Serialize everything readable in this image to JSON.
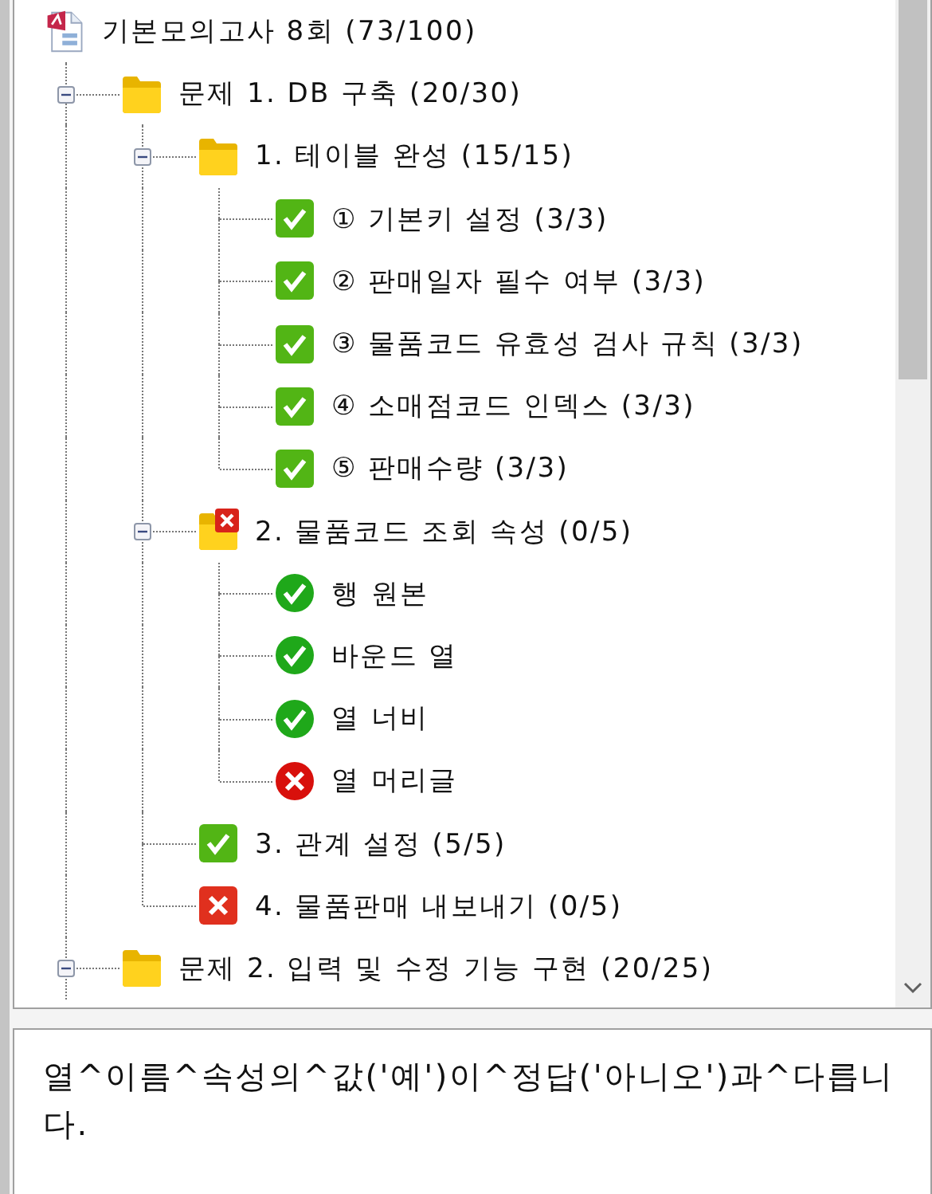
{
  "tree": [
    {
      "label": "기본모의고사 8회 (73/100)",
      "kind": "document",
      "children": [
        {
          "label": "문제 1. DB 구축 (20/30)",
          "kind": "folder",
          "passed": true,
          "expanded": true,
          "children": [
            {
              "label": "1. 테이블 완성 (15/15)",
              "kind": "folder",
              "passed": true,
              "expanded": true,
              "children": [
                {
                  "label": "① 기본키 설정 (3/3)",
                  "kind": "task",
                  "passed": true
                },
                {
                  "label": "② 판매일자 필수 여부 (3/3)",
                  "kind": "task",
                  "passed": true
                },
                {
                  "label": "③ 물품코드 유효성 검사 규칙 (3/3)",
                  "kind": "task",
                  "passed": true
                },
                {
                  "label": "④ 소매점코드 인덱스 (3/3)",
                  "kind": "task",
                  "passed": true
                },
                {
                  "label": "⑤ 판매수량 (3/3)",
                  "kind": "task",
                  "passed": true
                }
              ]
            },
            {
              "label": "2. 물품코드 조회 속성 (0/5)",
              "kind": "folder",
              "passed": false,
              "expanded": true,
              "children": [
                {
                  "label": "행 원본",
                  "kind": "check",
                  "passed": true
                },
                {
                  "label": "바운드 열",
                  "kind": "check",
                  "passed": true
                },
                {
                  "label": "열 너비",
                  "kind": "check",
                  "passed": true
                },
                {
                  "label": "열 머리글",
                  "kind": "check",
                  "passed": false
                }
              ]
            },
            {
              "label": "3. 관계 설정 (5/5)",
              "kind": "task",
              "passed": true
            },
            {
              "label": "4. 물품판매 내보내기 (0/5)",
              "kind": "task",
              "passed": false
            }
          ]
        },
        {
          "label": "문제 2. 입력 및 수정 기능 구현 (20/25)",
          "kind": "folder",
          "passed": true,
          "expanded": true
        }
      ]
    }
  ],
  "message": "열^이름^속성의^값('예')이^정답('아니오')과^다릅니다."
}
